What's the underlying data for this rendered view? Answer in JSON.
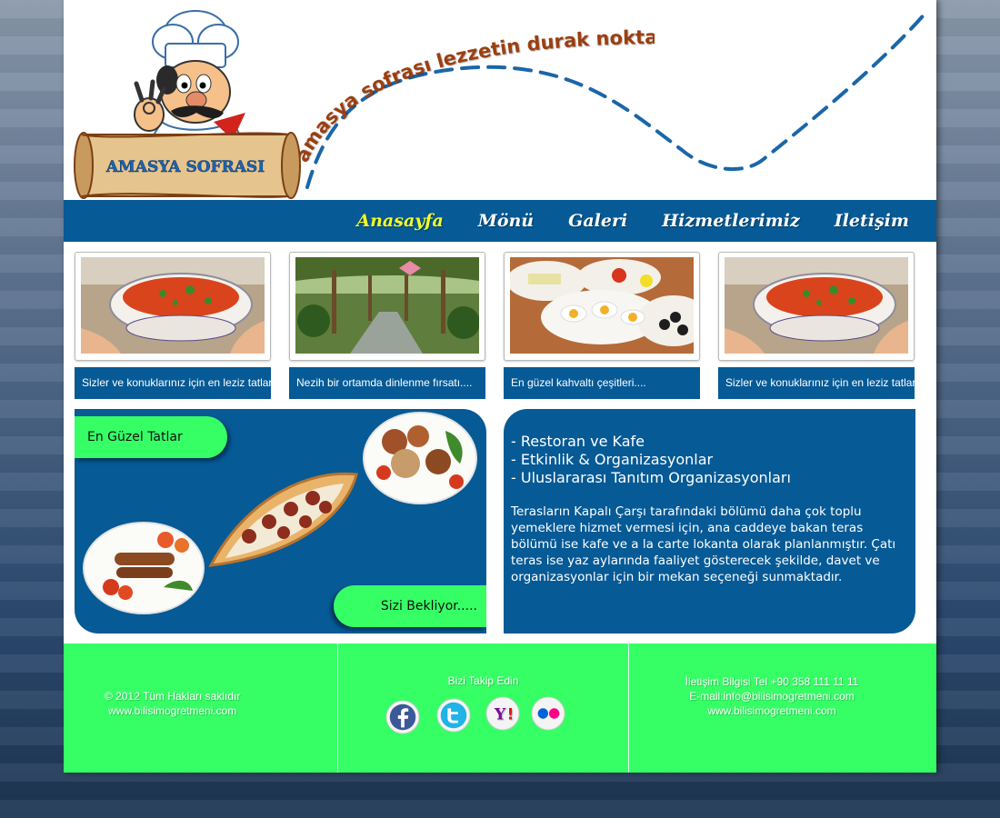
{
  "header": {
    "logo_text": "AMASYA SOFRASI",
    "slogan": "amasya sofrası lezzetin durak noktası"
  },
  "nav": {
    "items": [
      {
        "label": "Anasayfa",
        "active": true
      },
      {
        "label": "Mönü",
        "active": false
      },
      {
        "label": "Galeri",
        "active": false
      },
      {
        "label": "Hizmetlerimiz",
        "active": false
      },
      {
        "label": "Iletişim",
        "active": false
      }
    ]
  },
  "cards": [
    {
      "caption": "Sizler ve konuklarınız için en leziz tatlar..",
      "image": "tomato-soup-bowl"
    },
    {
      "caption": "Nezih bir ortamda dinlenme fırsatı....",
      "image": "garden-pergola"
    },
    {
      "caption": "En güzel kahvaltı çeşitleri....",
      "image": "breakfast-plates"
    },
    {
      "caption": "Sizler ve konuklarınız için en leziz tatlar..",
      "image": "tomato-soup-bowl"
    }
  ],
  "promo": {
    "top_label": "En Güzel Tatlar",
    "bottom_label": "Sizi Bekliyor....."
  },
  "info": {
    "services": [
      "- Restoran ve Kafe",
      "- Etkinlik & Organizasyonlar",
      "- Uluslararası Tanıtım Organizasyonları"
    ],
    "description": "Terasların Kapalı Çarşı tarafındaki bölümü daha çok toplu yemeklere hizmet vermesi için, ana caddeye bakan teras bölümü ise kafe ve a la carte lokanta olarak planlanmıştır. Çatı teras ise yaz aylarında faaliyet gösterecek şekilde, davet ve organizasyonlar için bir mekan seçeneği sunmaktadır."
  },
  "footer": {
    "copyright": "© 2012 Tüm Hakları saklıdır",
    "copyright_site": "www.bilisimogretmeni.com",
    "follow_title": "Bizi Takip Edin",
    "social": [
      "facebook-icon",
      "twitter-icon",
      "yahoo-icon",
      "flickr-icon"
    ],
    "contact_phone": "İletişim Bilgisi Tel +90 358 111 11 11",
    "contact_email": "E-mail:info@bilisimogretmeni.com",
    "contact_site": "www.bilisimogretmeni.com"
  },
  "colors": {
    "nav_blue": "#065a96",
    "accent_green": "#36ff66",
    "active_nav": "#f2ff2a",
    "logo_brown": "#7a3f14"
  }
}
